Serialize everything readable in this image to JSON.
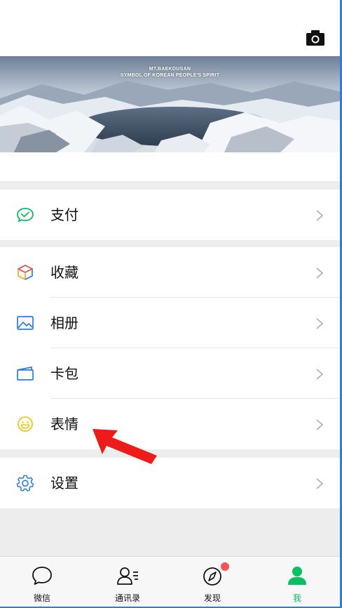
{
  "colors": {
    "accent_green": "#07c160",
    "icon_green": "#07c160",
    "icon_blue": "#2a7de1",
    "icon_yellow": "#f5c518",
    "badge_red": "#fa5151",
    "arrow_red": "#ee1b1b"
  },
  "header": {
    "banner_title": "MT.BAEKDUSAN",
    "banner_subtitle": "SYMBOL OF KOREAN PEOPLE'S SPIRIT",
    "camera_icon": "camera-icon"
  },
  "menu": {
    "pay": {
      "label": "支付",
      "icon": "pay-icon"
    },
    "favorites": {
      "label": "收藏",
      "icon": "cube-icon"
    },
    "album": {
      "label": "相册",
      "icon": "picture-icon"
    },
    "cards": {
      "label": "卡包",
      "icon": "wallet-icon"
    },
    "stickers": {
      "label": "表情",
      "icon": "smiley-icon"
    },
    "settings": {
      "label": "设置",
      "icon": "gear-icon"
    }
  },
  "tabbar": {
    "items": [
      {
        "label": "微信",
        "icon": "chat-icon",
        "active": false
      },
      {
        "label": "通讯录",
        "icon": "contacts-icon",
        "active": false
      },
      {
        "label": "发现",
        "icon": "compass-icon",
        "active": false,
        "badge": true
      },
      {
        "label": "我",
        "icon": "person-icon",
        "active": true
      }
    ]
  }
}
